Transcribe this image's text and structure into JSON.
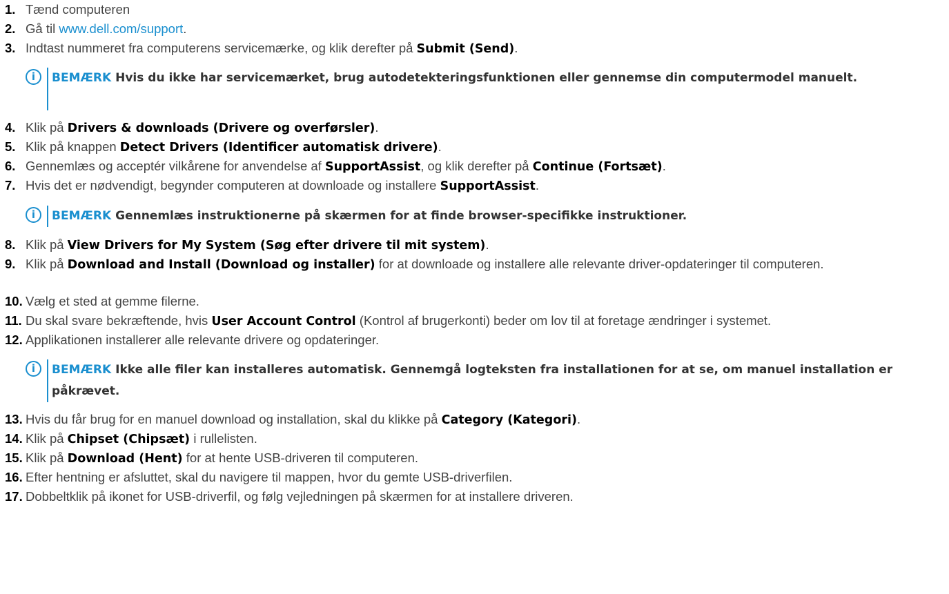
{
  "accent_color": "#1a8fcf",
  "steps": [
    {
      "num": "1.",
      "text": "Tænd computeren"
    },
    {
      "num": "2.",
      "pre": "Gå til ",
      "link": "www.dell.com/support",
      "post": "."
    },
    {
      "num": "3.",
      "pre": "Indtast nummeret fra computerens servicemærke, og klik derefter på ",
      "b1": "Submit (Send)",
      "post": "."
    },
    {
      "num": "4.",
      "pre": "Klik på ",
      "b1": "Drivers & downloads (Drivere og overførsler)",
      "post": "."
    },
    {
      "num": "5.",
      "pre": "Klik på knappen ",
      "b1": "Detect Drivers (Identificer automatisk drivere)",
      "post": "."
    },
    {
      "num": "6.",
      "pre": "Gennemlæs og acceptér vilkårene for anvendelse af ",
      "b1": "SupportAssist",
      "mid": ", og klik derefter på ",
      "b2": "Continue (Fortsæt)",
      "post": "."
    },
    {
      "num": "7.",
      "pre": "Hvis det er nødvendigt, begynder computeren at downloade og installere ",
      "b1": "SupportAssist",
      "post": "."
    },
    {
      "num": "8.",
      "pre": "Klik på ",
      "b1": "View Drivers for My System (Søg efter drivere til mit system)",
      "post": "."
    },
    {
      "num": "9.",
      "pre": "Klik på ",
      "b1": "Download and Install (Download og installer)",
      "post": " for at downloade og installere alle relevante driver-opdateringer til computeren."
    },
    {
      "num": "10.",
      "text": "Vælg et sted at gemme filerne."
    },
    {
      "num": "11.",
      "pre": "Du skal svare bekræftende, hvis ",
      "b1": "User Account Control",
      "post": " (Kontrol af brugerkonti) beder om lov til at foretage ændringer i systemet."
    },
    {
      "num": "12.",
      "text": "Applikationen installerer alle relevante drivere og opdateringer."
    },
    {
      "num": "13.",
      "pre": "Hvis du får brug for en manuel download og installation, skal du klikke på ",
      "b1": "Category (Kategori)",
      "post": "."
    },
    {
      "num": "14.",
      "pre": "Klik på ",
      "b1": "Chipset (Chipsæt)",
      "post": " i rullelisten."
    },
    {
      "num": "15.",
      "pre": "Klik på ",
      "b1": "Download (Hent)",
      "post": " for at hente USB-driveren til computeren."
    },
    {
      "num": "16.",
      "text": "Efter hentning er afsluttet, skal du navigere til mappen, hvor du gemte USB-driverfilen."
    },
    {
      "num": "17.",
      "text": "Dobbeltklik på ikonet for USB-driverfil, og følg vejledningen på skærmen for at installere driveren."
    }
  ],
  "notes": [
    {
      "label": "BEMÆRK",
      "text": " Hvis du ikke har servicemærket, brug autodetekteringsfunktionen eller gennemse din computermodel manuelt."
    },
    {
      "label": "BEMÆRK",
      "text": " Gennemlæs instruktionerne på skærmen for at finde browser-specifikke instruktioner."
    },
    {
      "label": "BEMÆRK",
      "text": " Ikke alle filer kan installeres automatisk. Gennemgå logteksten fra installationen for at se, om manuel installation er påkrævet."
    }
  ],
  "note_icon": "info-circle-icon"
}
